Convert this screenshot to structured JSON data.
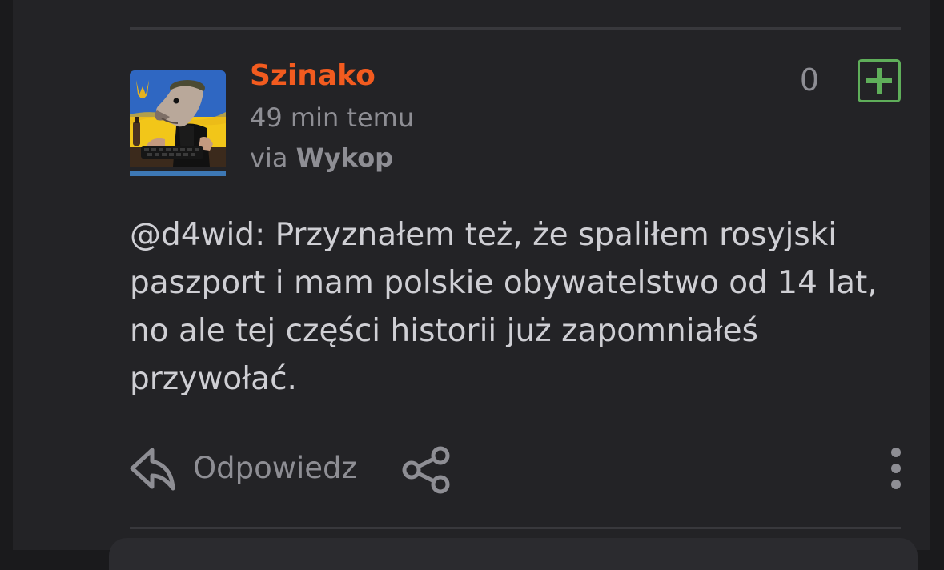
{
  "post": {
    "author": "Szinako",
    "time": "49 min temu",
    "via_prefix": "via",
    "via_app": "Wykop",
    "votes": "0",
    "mention": "@d4wid",
    "body": ": Przyznałem też, że spaliłem rosyjski paszport i mam polskie obywatelstwo od 14 lat, no ale tej części historii już zapomniałeś przywołać."
  },
  "actions": {
    "reply_label": "Odpowiedz"
  },
  "colors": {
    "author": "#f25b1f",
    "upvote": "#5fae5a",
    "muted": "#8e8e94",
    "text": "#cfcfd4",
    "avatar_underline": "#3d78b5"
  },
  "icons": {
    "upvote": "plus-square-icon",
    "reply": "reply-arrow-icon",
    "share": "share-icon",
    "more": "more-vertical-icon"
  }
}
